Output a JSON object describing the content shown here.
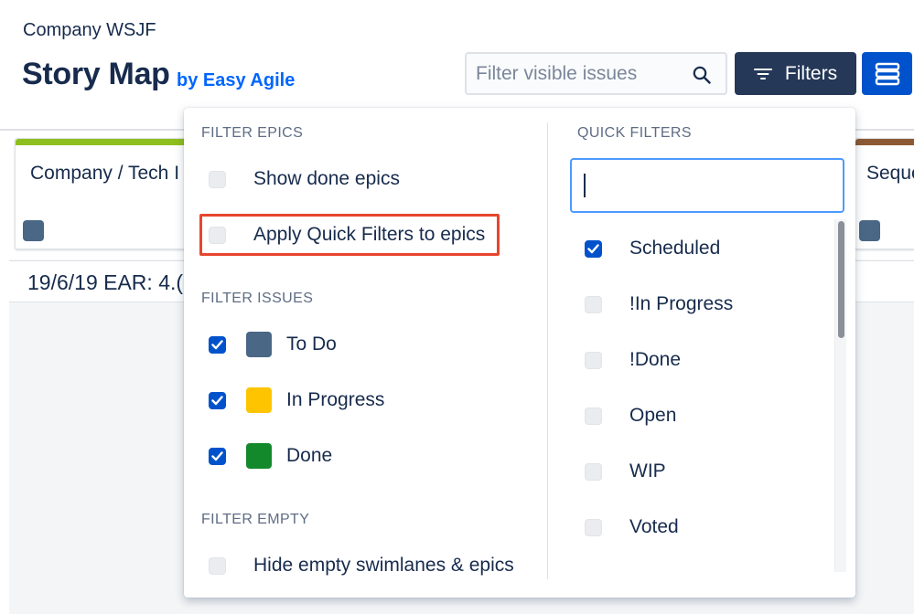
{
  "header": {
    "project_name": "Company WSJF",
    "app_title": "Story Map",
    "app_byline": "by Easy Agile",
    "search": {
      "placeholder": "Filter visible issues",
      "value": ""
    },
    "filters_button_label": "Filters"
  },
  "board": {
    "epics": [
      {
        "title": "Company / Tech I",
        "strip_color": "#8fbf1e",
        "badge_color": "#4a6785"
      },
      {
        "title": "Seque",
        "strip_color": "#8b5a34",
        "badge_color": "#4a6785"
      }
    ],
    "release_label": "19/6/19 EAR: 4.("
  },
  "filters_panel": {
    "filter_epics": {
      "heading": "FILTER EPICS",
      "options": [
        {
          "label": "Show done epics",
          "checked": false
        },
        {
          "label": "Apply Quick Filters to epics",
          "checked": false,
          "highlighted": true
        }
      ]
    },
    "filter_issues": {
      "heading": "FILTER ISSUES",
      "options": [
        {
          "label": "To Do",
          "checked": true,
          "color": "#4a6785"
        },
        {
          "label": "In Progress",
          "checked": true,
          "color": "#ffc400"
        },
        {
          "label": "Done",
          "checked": true,
          "color": "#14892c"
        }
      ]
    },
    "filter_empty": {
      "heading": "FILTER EMPTY",
      "options": [
        {
          "label": "Hide empty swimlanes & epics",
          "checked": false
        }
      ]
    },
    "quick_filters": {
      "heading": "QUICK FILTERS",
      "search_value": "",
      "options": [
        {
          "label": "Scheduled",
          "checked": true
        },
        {
          "label": "!In Progress",
          "checked": false
        },
        {
          "label": "!Done",
          "checked": false
        },
        {
          "label": "Open",
          "checked": false
        },
        {
          "label": "WIP",
          "checked": false
        },
        {
          "label": "Voted",
          "checked": false
        }
      ]
    }
  }
}
